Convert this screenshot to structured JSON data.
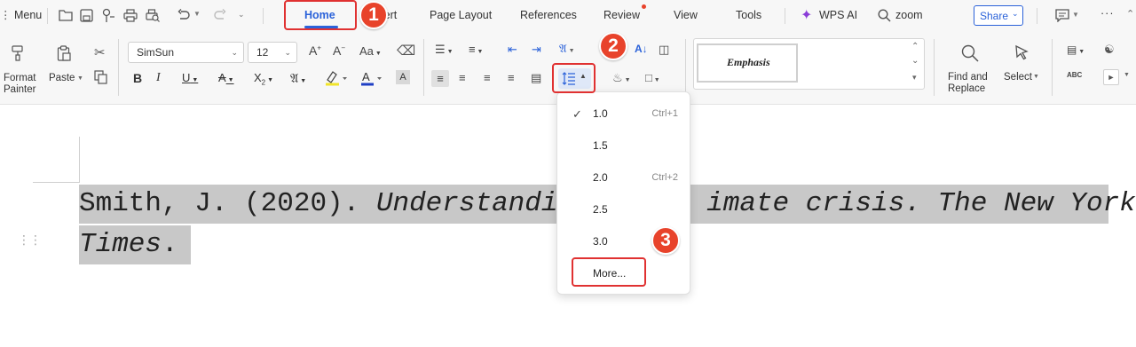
{
  "menubar": {
    "menu_label": "Menu",
    "tabs": [
      {
        "label": "Home"
      },
      {
        "label": "Insert"
      },
      {
        "label": "Page Layout"
      },
      {
        "label": "References"
      },
      {
        "label": "Review"
      },
      {
        "label": "View"
      },
      {
        "label": "Tools"
      }
    ],
    "wps_ai_label": "WPS AI",
    "search_label": "zoom",
    "share_label": "Share",
    "more_label": "···",
    "accent_color": "#2b62d9",
    "ai_color": "#8b3dd8"
  },
  "ribbon": {
    "format_painter_label": "Format\nPainter",
    "paste_label": "Paste",
    "font_name": "SimSun",
    "font_size": "12",
    "style_name": "Emphasis",
    "find_replace_label": "Find and\nReplace",
    "select_label": "Select"
  },
  "document": {
    "line1_plain": "Smith, J. (2020). ",
    "line1_italic_a": "Understandin",
    "line1_italic_b": "imate crisis. The New York",
    "line2_italic": "Times",
    "line2_tail": "."
  },
  "line_spacing_menu": {
    "items": [
      {
        "label": "1.0",
        "shortcut": "Ctrl+1",
        "checked": true
      },
      {
        "label": "1.5",
        "shortcut": "",
        "checked": false
      },
      {
        "label": "2.0",
        "shortcut": "Ctrl+2",
        "checked": false
      },
      {
        "label": "2.5",
        "shortcut": "",
        "checked": false
      },
      {
        "label": "3.0",
        "shortcut": "",
        "checked": false
      }
    ],
    "more_label": "More..."
  },
  "annotations": {
    "step1": "1",
    "step2": "2",
    "step3": "3",
    "color": "#e03131"
  }
}
